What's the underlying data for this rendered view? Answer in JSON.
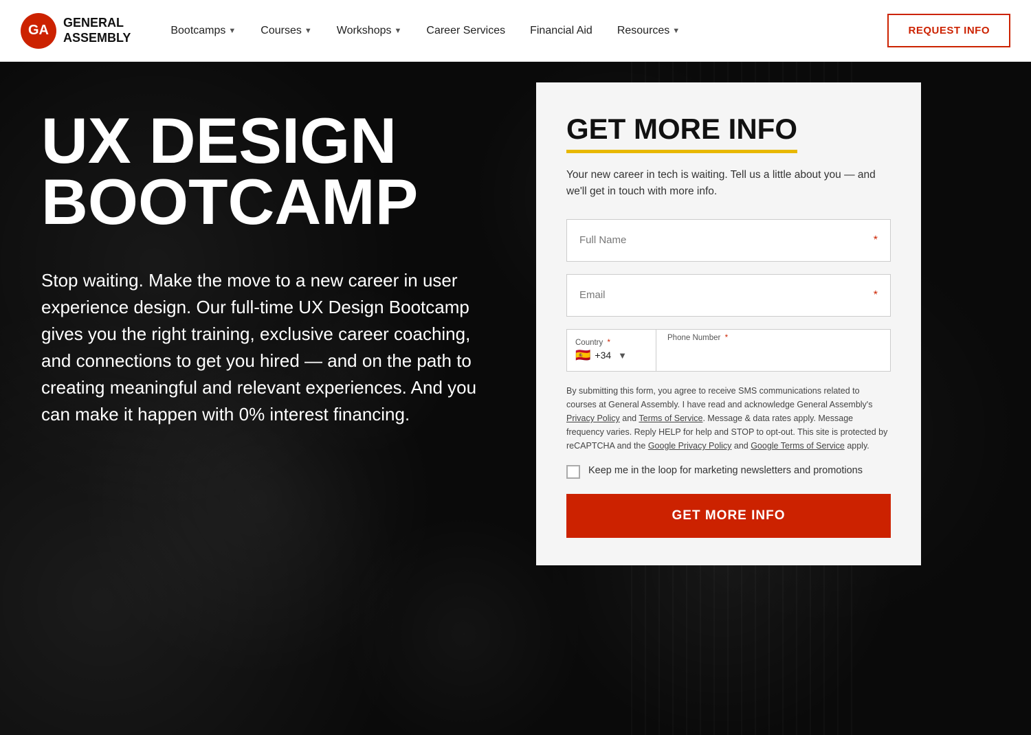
{
  "brand": {
    "logo_initials": "GA",
    "logo_name_line1": "GENERAL",
    "logo_name_line2": "ASSEMBLY"
  },
  "navbar": {
    "items": [
      {
        "label": "Bootcamps",
        "has_dropdown": true
      },
      {
        "label": "Courses",
        "has_dropdown": true
      },
      {
        "label": "Workshops",
        "has_dropdown": true
      },
      {
        "label": "Career Services",
        "has_dropdown": false
      },
      {
        "label": "Financial Aid",
        "has_dropdown": false
      },
      {
        "label": "Resources",
        "has_dropdown": true
      }
    ],
    "request_info_label": "REQUEST INFO"
  },
  "hero": {
    "title_line1": "UX DESIGN",
    "title_line2": "BOOTCAMP",
    "description": "Stop waiting. Make the move to a new career in user experience design. Our full-time UX Design Bootcamp gives you the right training, exclusive career coaching, and connections to get you hired — and on the path to creating meaningful and relevant experiences. And you can make it happen with 0% interest financing."
  },
  "form": {
    "title": "GET MORE INFO",
    "subtitle": "Your new career in tech is waiting. Tell us a little about you — and we'll get in touch with more info.",
    "full_name_placeholder": "Full Name",
    "full_name_required": "*",
    "email_placeholder": "Email",
    "email_required": "*",
    "country_label": "Country",
    "country_required": "*",
    "country_flag": "🇪🇸",
    "country_code": "+34",
    "phone_label": "Phone Number",
    "phone_required": "*",
    "consent_text": "By submitting this form, you agree to receive SMS communications related to courses at General Assembly. I have read and acknowledge General Assembly's ",
    "privacy_policy_link": "Privacy Policy",
    "and_text": " and ",
    "terms_link": "Terms of Service",
    "consent_text2": ". Message & data rates apply. Message frequency varies. Reply HELP for help and STOP to opt-out.\nThis site is protected by reCAPTCHA and the ",
    "google_privacy_link": "Google Privacy Policy",
    "and_text2": " and ",
    "google_terms_link": "Google Terms of Service",
    "consent_text3": " apply.",
    "checkbox_label": "Keep me in the loop for marketing newsletters and promotions",
    "submit_label": "GET MORE INFO"
  }
}
